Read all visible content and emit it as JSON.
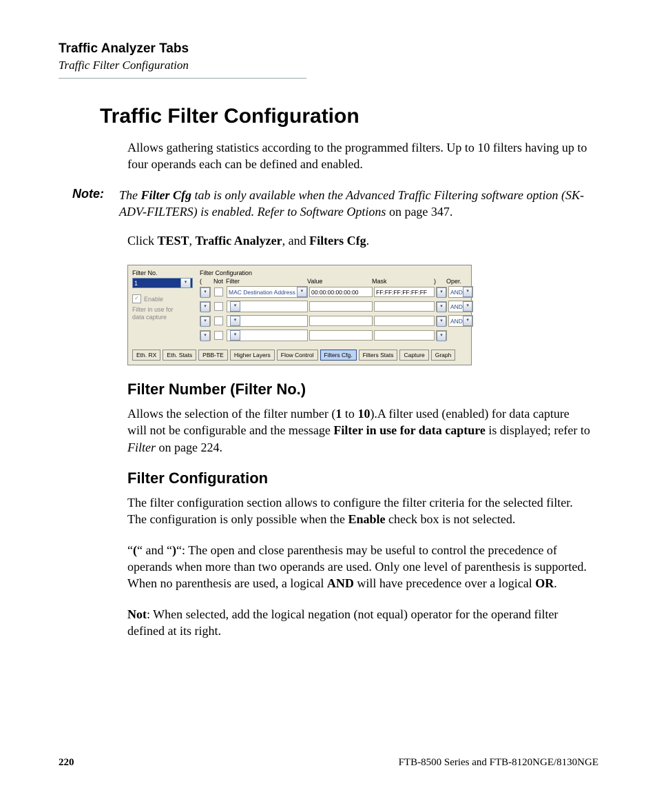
{
  "header": {
    "main": "Traffic Analyzer Tabs",
    "sub": "Traffic Filter Configuration"
  },
  "title": "Traffic Filter Configuration",
  "intro": "Allows gathering statistics according to the programmed filters. Up to 10 filters having up to four operands each can be defined and enabled.",
  "note": {
    "label": "Note:",
    "l1_pre": "The ",
    "l1_bi": "Filter Cfg",
    "l1_post": " tab is only available when the Advanced Traffic Filtering software option (SK-ADV-FILTERS) is enabled. Refer to Software Options",
    "l2": " on page 347."
  },
  "click": {
    "pre": "Click ",
    "a": "TEST",
    "sep1": ", ",
    "b": "Traffic Analyzer",
    "sep2": ", and ",
    "c": "Filters Cfg",
    "post": "."
  },
  "screenshot": {
    "filter_no_label": "Filter No.",
    "filter_no_value": "1",
    "enable_label": "Enable",
    "enable_checked": "✓",
    "in_use_l1": "Filter in use for",
    "in_use_l2": "data capture",
    "cfg_label": "Filter Configuration",
    "cols": {
      "paren_open": "(",
      "not": "Not",
      "filter": "Filter",
      "value": "Value",
      "mask": "Mask",
      "paren_close": ")",
      "oper": "Oper."
    },
    "row1": {
      "filter": "MAC Destination Address",
      "value": "00:00:00:00:00:00",
      "mask": "FF:FF:FF:FF:FF:FF",
      "oper": "AND"
    },
    "row2": {
      "filter": "",
      "value": "",
      "mask": "",
      "oper": "AND"
    },
    "row3": {
      "filter": "",
      "value": "",
      "mask": "",
      "oper": "AND"
    },
    "row4": {
      "filter": "",
      "value": "",
      "mask": "",
      "oper": ""
    },
    "tabs": [
      "Eth. RX",
      "Eth. Stats",
      "PBB-TE",
      "Higher Layers",
      "Flow Control",
      "Filters Cfg.",
      "Filters Stats",
      "Capture",
      "Graph"
    ],
    "tab_active_index": 5
  },
  "sec1": {
    "heading": "Filter Number (Filter No.)",
    "p1_a": "Allows the selection of the filter number (",
    "p1_b": "1",
    "p1_c": " to ",
    "p1_d": "10",
    "p1_e": ").A filter used (enabled) for data capture will not be configurable and the message ",
    "p1_f": "Filter in use for data capture",
    "p1_g": " is displayed; refer to ",
    "p1_h": "Filter",
    "p1_i": " on page 224."
  },
  "sec2": {
    "heading": "Filter Configuration",
    "p1_a": "The filter configuration section allows to configure the filter criteria for the selected filter. The configuration is only possible when the ",
    "p1_b": "Enable",
    "p1_c": " check box is not selected.",
    "p2_a": "“",
    "p2_b": "(",
    "p2_c": "“ and “",
    "p2_d": ")",
    "p2_e": "“: The open and close parenthesis may be useful to control the precedence of operands when more than two operands are used. Only one level of parenthesis is supported. When no parenthesis are used, a logical ",
    "p2_f": "AND",
    "p2_g": " will have precedence over a logical ",
    "p2_h": "OR",
    "p2_i": ".",
    "p3_a": "Not",
    "p3_b": ": When selected, add the logical negation (not equal) operator for the operand filter defined at its right."
  },
  "footer": {
    "page": "220",
    "doc": "FTB-8500 Series and FTB-8120NGE/8130NGE"
  }
}
